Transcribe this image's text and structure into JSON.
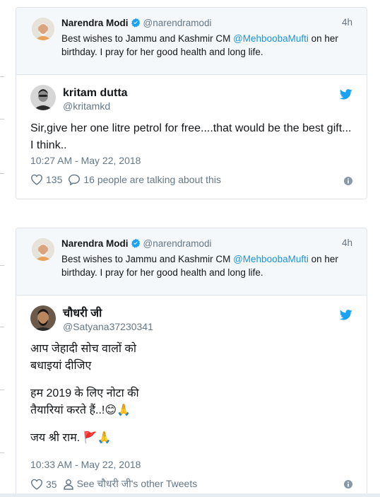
{
  "tweet1": {
    "quoted": {
      "name": "Narendra Modi",
      "handle": "@narendramodi",
      "time": "4h",
      "text_before": "Best wishes to Jammu and Kashmir CM ",
      "mention": "@MehboobaMufti",
      "text_after": " on her birthday. I pray for her good health and long life."
    },
    "reply": {
      "name": "kritam dutta",
      "handle": "@kritamkd",
      "text": "Sir,give her one litre petrol for free....that would be the best gift... I think..",
      "date": "10:27 AM - May 22, 2018",
      "likes": "135",
      "talking": "16 people are talking about this"
    }
  },
  "tweet2": {
    "quoted": {
      "name": "Narendra Modi",
      "handle": "@narendramodi",
      "time": "4h",
      "text_before": "Best wishes to Jammu and Kashmir CM ",
      "mention": "@MehboobaMufti",
      "text_after": " on her birthday. I pray for her good health and long life."
    },
    "reply": {
      "name": "चौधरी जी",
      "handle": "@Satyana37230341",
      "line1": "आप जेहादी सोच वालों को",
      "line2": "बधाइयां दीजिए",
      "line3": "हम 2019 के लिए नोटा की",
      "line4": "तैयारियां करते हैं..!😊🙏",
      "line5": "जय श्री राम. 🚩🙏",
      "date": "10:33 AM - May 22, 2018",
      "likes": "35",
      "other_tweets": "See चौधरी जी's other Tweets"
    }
  },
  "colors": {
    "link": "#1b95e0",
    "twitter_blue": "#1da1f2",
    "muted": "#657786",
    "quoted_bg": "#f5f8fa"
  },
  "icons": [
    "verified-badge-icon",
    "twitter-bird-icon",
    "heart-icon",
    "reply-bubble-icon",
    "person-icon",
    "info-icon"
  ]
}
